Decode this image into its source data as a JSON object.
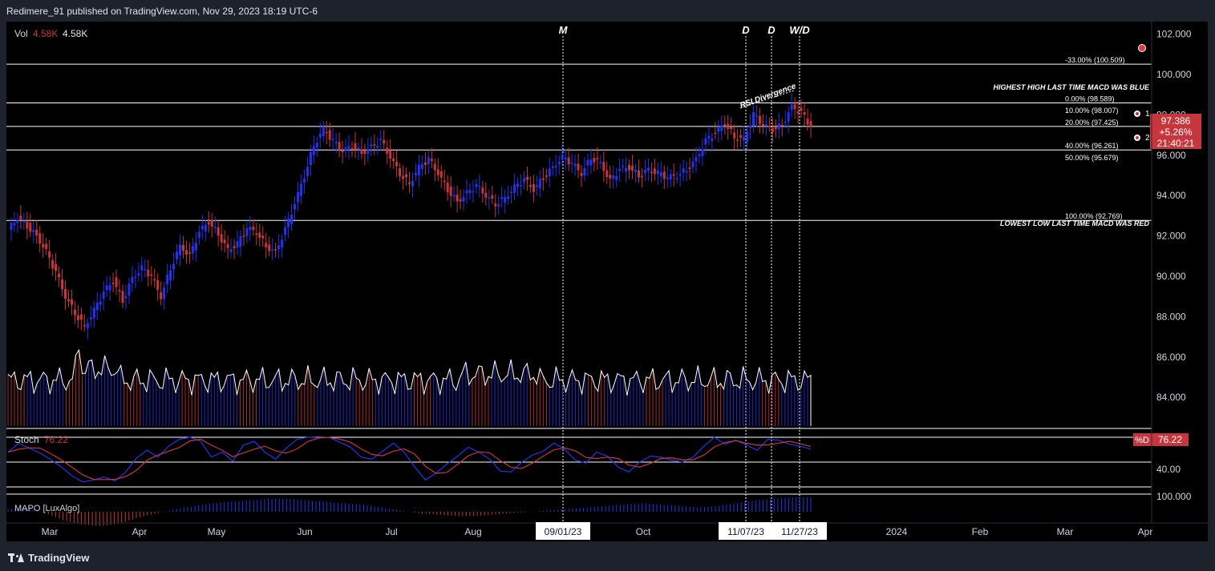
{
  "header": {
    "publisher": "Redimere_91 published on TradingView.com, Nov 29, 2023 18:19 UTC-6"
  },
  "footer": {
    "brand": "TradingView"
  },
  "legend": {
    "vol_label": "Vol",
    "vol_value_red": "4.58K",
    "vol_value_white": "4.58K",
    "stoch_label": "Stoch",
    "stoch_value": "76.22",
    "mapo_label": "MAPO [LuxAlgo]"
  },
  "colors": {
    "up": "#2233ee",
    "down": "#c7363d",
    "price_badge": "#c7363d",
    "text": "#d1d4dc",
    "line": "#ffffff"
  },
  "chart_data": [
    {
      "type": "candlestick",
      "ylim": [
        82.5,
        102.5
      ],
      "y_ticks": [
        "102.000",
        "100.000",
        "98.000",
        "96.000",
        "94.000",
        "92.000",
        "90.000",
        "88.000",
        "86.000",
        "84.000"
      ],
      "x_ticks": [
        "Mar",
        "Apr",
        "May",
        "Jun",
        "Jul",
        "Aug",
        "Oct",
        "2024",
        "Feb",
        "Mar",
        "Apr"
      ],
      "date_badges": [
        "09/01/23",
        "11/07/23",
        "11/27/23"
      ],
      "price_badge": {
        "price": "97.386",
        "change": "+5.26%",
        "countdown": "21:40:21"
      },
      "price_path": [
        92.3,
        92.9,
        92.5,
        92.0,
        91.2,
        90.2,
        89.0,
        88.2,
        87.5,
        88.3,
        89.2,
        89.8,
        88.8,
        89.9,
        90.4,
        90.0,
        89.0,
        90.4,
        91.5,
        91.0,
        92.2,
        92.7,
        92.1,
        91.3,
        91.6,
        92.4,
        92.2,
        91.5,
        91.2,
        92.3,
        93.6,
        95.0,
        96.5,
        97.3,
        96.7,
        96.2,
        96.5,
        96.1,
        96.4,
        96.7,
        95.9,
        95.1,
        94.6,
        95.4,
        95.8,
        95.1,
        94.3,
        93.7,
        94.1,
        94.5,
        94.0,
        93.6,
        93.9,
        94.4,
        94.8,
        94.3,
        94.9,
        95.4,
        95.9,
        95.6,
        95.1,
        95.9,
        95.6,
        94.7,
        95.3,
        95.4,
        95.0,
        95.3,
        95.1,
        94.9,
        95.0,
        95.3,
        95.8,
        96.7,
        97.1,
        97.6,
        96.9,
        96.8,
        98.0,
        97.5,
        97.3,
        97.5,
        98.4,
        98.1,
        97.386
      ],
      "fib_levels": [
        {
          "label": "-33.00% (100.509)",
          "price": 100.509
        },
        {
          "label": "0.00% (98.589)",
          "price": 98.589
        },
        {
          "label": "10.00% (98.007)",
          "price": 98.007
        },
        {
          "label": "20.00% (97.425)",
          "price": 97.425
        },
        {
          "label": "40.00% (96.261)",
          "price": 96.261
        },
        {
          "label": "50.00% (95.679)",
          "price": 95.679
        },
        {
          "label": "100.00% (92.769)",
          "price": 92.769
        }
      ],
      "level_notes": [
        "HIGHEST HIGH LAST TIME MACD WAS BLUE",
        "LOWEST LOW LAST TIME MACD WAS RED"
      ],
      "markers": [
        "M",
        "D",
        "D",
        "W/D"
      ],
      "annotation": "RSI Divergence",
      "target_labels": [
        "1",
        "2"
      ]
    },
    {
      "type": "line",
      "name": "Stoch",
      "y_ticks": [
        "40.00"
      ],
      "badge": {
        "label": "%D",
        "value": "76.22"
      },
      "values": [
        70,
        88,
        78,
        68,
        55,
        40,
        22,
        10,
        14,
        20,
        12,
        30,
        58,
        74,
        60,
        82,
        96,
        100,
        92,
        60,
        70,
        52,
        84,
        92,
        70,
        56,
        78,
        96,
        100,
        99,
        100,
        90,
        80,
        60,
        56,
        72,
        88,
        70,
        40,
        14,
        28,
        46,
        62,
        80,
        70,
        56,
        32,
        30,
        50,
        64,
        72,
        88,
        76,
        54,
        48,
        70,
        62,
        40,
        30,
        50,
        62,
        60,
        54,
        50,
        60,
        82,
        100,
        86,
        94,
        84,
        74,
        96,
        94,
        86,
        82,
        76.22
      ]
    },
    {
      "type": "bar",
      "name": "MAPO [LuxAlgo]",
      "y_ticks": [
        "100.000"
      ],
      "values": [
        0.2,
        0.3,
        -0.1,
        -0.6,
        -0.9,
        -1.0,
        -0.8,
        -0.4,
        -0.1,
        0.2,
        0.4,
        0.6,
        0.7,
        0.8,
        0.9,
        0.9,
        0.8,
        0.7,
        0.6,
        0.5,
        0.3,
        0.1,
        -0.1,
        -0.2,
        -0.3,
        -0.3,
        -0.2,
        -0.1,
        0.0,
        0.1,
        0.2,
        0.3,
        0.4,
        0.5,
        0.6,
        0.5,
        0.4,
        0.3,
        0.4,
        0.6,
        0.8,
        0.9,
        1.0,
        1.0
      ]
    }
  ]
}
